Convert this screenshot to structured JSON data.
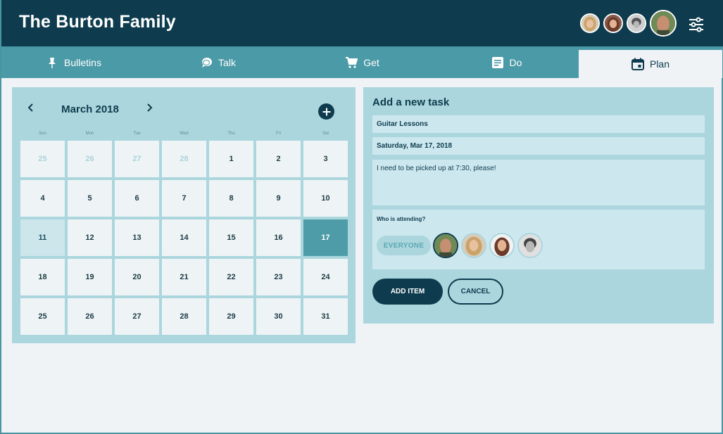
{
  "header": {
    "title": "The Burton Family",
    "members": [
      {
        "name": "member-avatar-woman-blonde",
        "hair": "#c9a36a",
        "skin": "#e8c2a0"
      },
      {
        "name": "member-avatar-woman-brunette",
        "hair": "#6b3b2a",
        "skin": "#e3b394"
      },
      {
        "name": "member-avatar-grayscale",
        "hair": "#555555",
        "skin": "#b8b8b8"
      },
      {
        "name": "member-avatar-man-bald",
        "hair": "#9c6b50",
        "skin": "#c68f72"
      }
    ]
  },
  "tabs": [
    {
      "label": "Bulletins",
      "icon": "pushpin-icon"
    },
    {
      "label": "Talk",
      "icon": "speech-bubble-icon"
    },
    {
      "label": "Get",
      "icon": "shopping-cart-icon"
    },
    {
      "label": "Do",
      "icon": "checklist-icon"
    },
    {
      "label": "Plan",
      "icon": "calendar-icon",
      "active": true
    }
  ],
  "calendar": {
    "month_label": "March 2018",
    "weekdays": [
      "Sun",
      "Mon",
      "Tue",
      "Wed",
      "Thu",
      "Fri",
      "Sat"
    ],
    "weeks": [
      [
        {
          "d": "25",
          "other": true
        },
        {
          "d": "26",
          "other": true
        },
        {
          "d": "27",
          "other": true
        },
        {
          "d": "28",
          "other": true
        },
        {
          "d": "1"
        },
        {
          "d": "2"
        },
        {
          "d": "3"
        }
      ],
      [
        {
          "d": "4"
        },
        {
          "d": "5"
        },
        {
          "d": "6"
        },
        {
          "d": "7"
        },
        {
          "d": "8"
        },
        {
          "d": "9"
        },
        {
          "d": "10"
        }
      ],
      [
        {
          "d": "11",
          "today": true
        },
        {
          "d": "12"
        },
        {
          "d": "13"
        },
        {
          "d": "14"
        },
        {
          "d": "15"
        },
        {
          "d": "16"
        },
        {
          "d": "17",
          "selected": true
        }
      ],
      [
        {
          "d": "18"
        },
        {
          "d": "19"
        },
        {
          "d": "20"
        },
        {
          "d": "21"
        },
        {
          "d": "22"
        },
        {
          "d": "23"
        },
        {
          "d": "24"
        }
      ],
      [
        {
          "d": "25"
        },
        {
          "d": "26"
        },
        {
          "d": "27"
        },
        {
          "d": "28"
        },
        {
          "d": "29"
        },
        {
          "d": "30"
        },
        {
          "d": "31"
        }
      ]
    ]
  },
  "task_form": {
    "title": "Add a new task",
    "task_name": "Guitar Lessons",
    "date": "Saturday, Mar 17, 2018",
    "notes": "I need to be picked up at 7:30, please!",
    "attending_label": "Who is attending?",
    "everyone_label": "EVERYONE",
    "add_label": "ADD ITEM",
    "cancel_label": "CANCEL"
  },
  "colors": {
    "header_bg": "#0e3c4e",
    "tab_bg": "#4b9aa7",
    "panel_bg": "#abd6dd",
    "selected_day": "#4e9ca8"
  }
}
